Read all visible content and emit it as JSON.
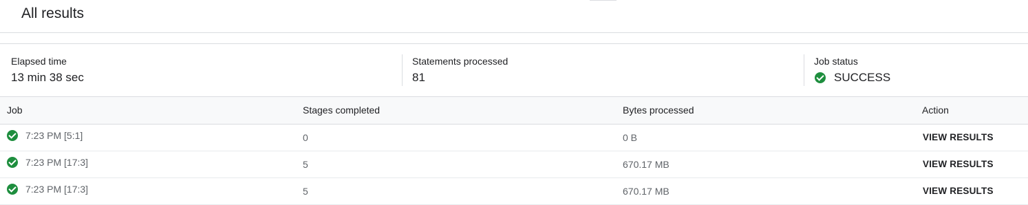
{
  "header": {
    "title": "All results"
  },
  "summary": {
    "elapsed_label": "Elapsed time",
    "elapsed_value": "13 min 38 sec",
    "statements_label": "Statements processed",
    "statements_value": "81",
    "status_label": "Job status",
    "status_value": "SUCCESS",
    "status_icon": "check-circle-icon",
    "status_color": "#1e8e3e"
  },
  "table": {
    "columns": [
      "Job",
      "Stages completed",
      "Bytes processed",
      "Action"
    ],
    "rows": [
      {
        "job": "7:23 PM [5:1]",
        "stages": "0",
        "bytes": "0 B",
        "action": "VIEW RESULTS"
      },
      {
        "job": "7:23 PM [17:3]",
        "stages": "5",
        "bytes": "670.17 MB",
        "action": "VIEW RESULTS"
      },
      {
        "job": "7:23 PM [17:3]",
        "stages": "5",
        "bytes": "670.17 MB",
        "action": "VIEW RESULTS"
      }
    ]
  }
}
